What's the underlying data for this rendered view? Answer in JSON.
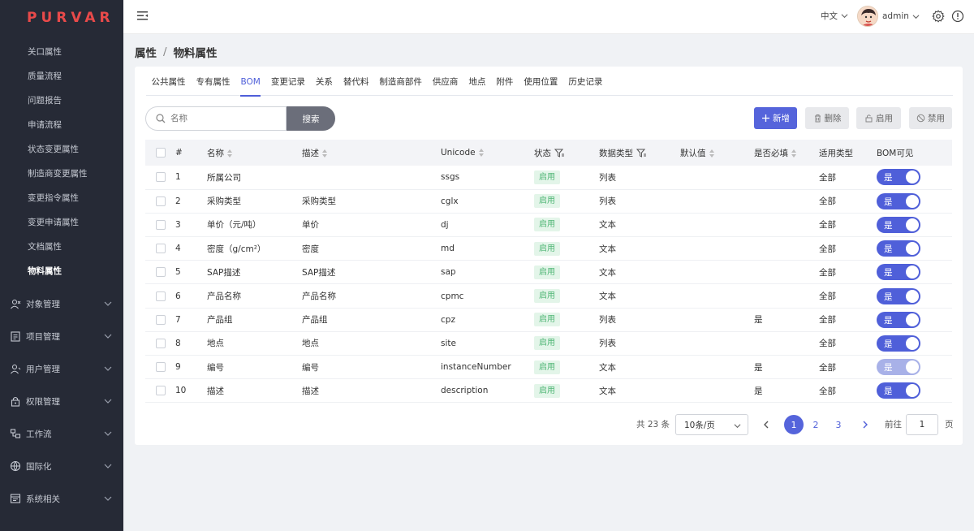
{
  "app": {
    "logo": "PURVAR"
  },
  "sidebar": {
    "sub_items": [
      {
        "label": "关口属性"
      },
      {
        "label": "质量流程"
      },
      {
        "label": "问题报告"
      },
      {
        "label": "申请流程"
      },
      {
        "label": "状态变更属性"
      },
      {
        "label": "制造商变更属性"
      },
      {
        "label": "变更指令属性"
      },
      {
        "label": "变更申请属性"
      },
      {
        "label": "文档属性"
      },
      {
        "label": "物料属性",
        "active": true
      }
    ],
    "groups": [
      {
        "label": "对象管理",
        "icon": "object-icon"
      },
      {
        "label": "项目管理",
        "icon": "project-icon"
      },
      {
        "label": "用户管理",
        "icon": "user-icon"
      },
      {
        "label": "权限管理",
        "icon": "lock-icon"
      },
      {
        "label": "工作流",
        "icon": "workflow-icon"
      },
      {
        "label": "国际化",
        "icon": "globe-icon"
      },
      {
        "label": "系统相关",
        "icon": "system-icon"
      }
    ]
  },
  "topbar": {
    "language": "中文",
    "username": "admin"
  },
  "breadcrumb": {
    "parent": "属性",
    "separator": "/",
    "current": "物料属性"
  },
  "tabs": [
    "公共属性",
    "专有属性",
    "BOM",
    "变更记录",
    "关系",
    "替代料",
    "制造商部件",
    "供应商",
    "地点",
    "附件",
    "使用位置",
    "历史记录"
  ],
  "active_tab": "BOM",
  "search": {
    "placeholder": "名称",
    "button": "搜索"
  },
  "actions": {
    "add": "新增",
    "delete": "删除",
    "enable": "启用",
    "disable": "禁用"
  },
  "table": {
    "columns": {
      "index": "#",
      "name": "名称",
      "desc": "描述",
      "unicode": "Unicode",
      "status": "状态",
      "dtype": "数据类型",
      "default": "默认值",
      "required": "是否必填",
      "applies": "适用类型",
      "bom_visible": "BOM可见"
    },
    "rows": [
      {
        "index": "1",
        "name": "所属公司",
        "desc": "",
        "unicode": "ssgs",
        "status": "启用",
        "dtype": "列表",
        "default": "",
        "required": "",
        "applies": "全部",
        "bom": "是",
        "bom_disabled": false
      },
      {
        "index": "2",
        "name": "采购类型",
        "desc": "采购类型",
        "unicode": "cglx",
        "status": "启用",
        "dtype": "列表",
        "default": "",
        "required": "",
        "applies": "全部",
        "bom": "是",
        "bom_disabled": false
      },
      {
        "index": "3",
        "name": "单价（元/吨）",
        "desc": "单价",
        "unicode": "dj",
        "status": "启用",
        "dtype": "文本",
        "default": "",
        "required": "",
        "applies": "全部",
        "bom": "是",
        "bom_disabled": false
      },
      {
        "index": "4",
        "name": "密度（g/cm²）",
        "desc": "密度",
        "unicode": "md",
        "status": "启用",
        "dtype": "文本",
        "default": "",
        "required": "",
        "applies": "全部",
        "bom": "是",
        "bom_disabled": false
      },
      {
        "index": "5",
        "name": "SAP描述",
        "desc": "SAP描述",
        "unicode": "sap",
        "status": "启用",
        "dtype": "文本",
        "default": "",
        "required": "",
        "applies": "全部",
        "bom": "是",
        "bom_disabled": false
      },
      {
        "index": "6",
        "name": "产品名称",
        "desc": "产品名称",
        "unicode": "cpmc",
        "status": "启用",
        "dtype": "文本",
        "default": "",
        "required": "",
        "applies": "全部",
        "bom": "是",
        "bom_disabled": false
      },
      {
        "index": "7",
        "name": "产品组",
        "desc": "产品组",
        "unicode": "cpz",
        "status": "启用",
        "dtype": "列表",
        "default": "",
        "required": "是",
        "applies": "全部",
        "bom": "是",
        "bom_disabled": false
      },
      {
        "index": "8",
        "name": "地点",
        "desc": "地点",
        "unicode": "site",
        "status": "启用",
        "dtype": "列表",
        "default": "",
        "required": "",
        "applies": "全部",
        "bom": "是",
        "bom_disabled": false
      },
      {
        "index": "9",
        "name": "编号",
        "desc": "编号",
        "unicode": "instanceNumber",
        "status": "启用",
        "dtype": "文本",
        "default": "",
        "required": "是",
        "applies": "全部",
        "bom": "是",
        "bom_disabled": true
      },
      {
        "index": "10",
        "name": "描述",
        "desc": "描述",
        "unicode": "description",
        "status": "启用",
        "dtype": "文本",
        "default": "",
        "required": "是",
        "applies": "全部",
        "bom": "是",
        "bom_disabled": false
      }
    ]
  },
  "pagination": {
    "total": "共 23 条",
    "page_size": "10条/页",
    "pages": [
      "1",
      "2",
      "3"
    ],
    "current": "1",
    "goto_label": "前往",
    "goto_value": "1",
    "goto_suffix": "页"
  },
  "colors": {
    "sidebar_bg": "#262a36",
    "logo": "#e84a4a",
    "accent": "#5564db",
    "status_green": "#4eb574"
  }
}
